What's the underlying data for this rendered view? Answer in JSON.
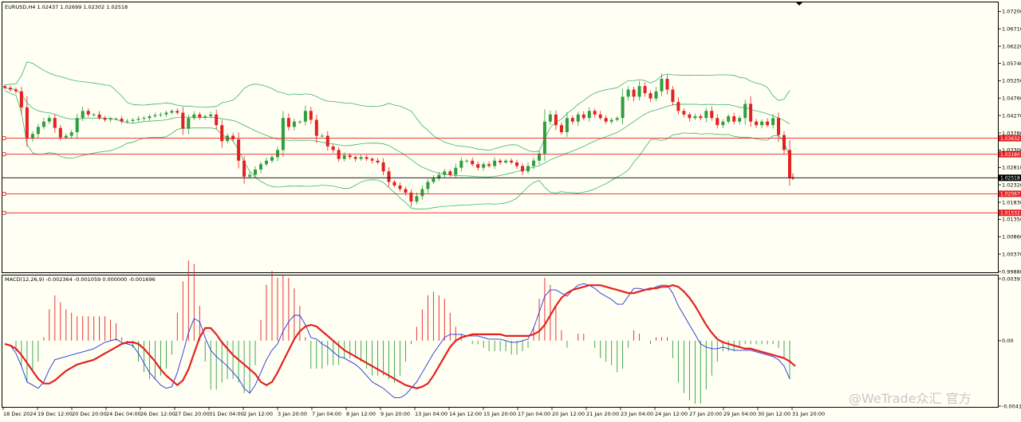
{
  "chart_data": [
    {
      "type": "candlestick",
      "symbol_line": "EURUSD,H4  1.02437 1.02699 1.02302 1.02518",
      "ylim": [
        0.9988,
        1.0732
      ],
      "y_ticks": [
        1.072,
        1.0671,
        1.0622,
        1.0574,
        1.0525,
        1.0476,
        1.0427,
        1.0378,
        1.033,
        1.0281,
        1.0232,
        1.0183,
        1.0135,
        1.0086,
        1.0037,
        0.9988
      ],
      "y_tick_labels": [
        "1.07200",
        "1.06710",
        "1.06220",
        "1.05740",
        "1.05250",
        "1.04760",
        "1.04270",
        "1.03780",
        "1.03300",
        "1.02810",
        "1.02320",
        "1.01830",
        "1.01350",
        "1.00860",
        "1.00370",
        "0.99880"
      ],
      "x_tick_labels": [
        "18 Dec 2024",
        "19 Dec 12:00",
        "20 Dec 20:00",
        "24 Dec 04:00",
        "26 Dec 12:00",
        "27 Dec 20:00",
        "31 Dec 04:00",
        "2 Jan 12:00",
        "3 Jan 20:00",
        "7 Jan 04:00",
        "8 Jan 12:00",
        "9 Jan 20:00",
        "13 Jan 04:00",
        "14 Jan 12:00",
        "15 Jan 20:00",
        "17 Jan 04:00",
        "20 Jan 12:00",
        "21 Jan 20:00",
        "23 Jan 04:00",
        "24 Jan 12:00",
        "27 Jan 20:00",
        "29 Jan 04:00",
        "30 Jan 12:00",
        "31 Jan 20:00"
      ],
      "close_series": [
        1.0505,
        1.05,
        1.0495,
        1.045,
        1.0362,
        1.0375,
        1.0395,
        1.041,
        1.042,
        1.0392,
        1.0365,
        1.037,
        1.038,
        1.042,
        1.044,
        1.043,
        1.043,
        1.042,
        1.0415,
        1.0418,
        1.0418,
        1.041,
        1.0412,
        1.0415,
        1.0418,
        1.042,
        1.0425,
        1.0428,
        1.043,
        1.0435,
        1.044,
        1.0435,
        1.039,
        1.042,
        1.043,
        1.0422,
        1.0425,
        1.043,
        1.04,
        1.0355,
        1.037,
        1.036,
        1.03,
        1.0255,
        1.026,
        1.0275,
        1.029,
        1.03,
        1.031,
        1.033,
        1.042,
        1.0395,
        1.041,
        1.041,
        1.044,
        1.0415,
        1.037,
        1.037,
        1.034,
        1.033,
        1.0305,
        1.0315,
        1.031,
        1.0305,
        1.031,
        1.0305,
        1.03,
        1.0295,
        1.027,
        1.024,
        1.023,
        1.022,
        1.021,
        1.0185,
        1.02,
        1.022,
        1.024,
        1.025,
        1.026,
        1.027,
        1.026,
        1.028,
        1.03,
        1.03,
        1.029,
        1.028,
        1.029,
        1.0285,
        1.03,
        1.0295,
        1.03,
        1.0295,
        1.0285,
        1.027,
        1.0285,
        1.03,
        1.032,
        1.041,
        1.043,
        1.04,
        1.038,
        1.042,
        1.041,
        1.043,
        1.042,
        1.044,
        1.043,
        1.042,
        1.041,
        1.0415,
        1.042,
        1.048,
        1.05,
        1.048,
        1.051,
        1.049,
        1.0475,
        1.0495,
        1.053,
        1.05,
        1.0465,
        1.044,
        1.043,
        1.042,
        1.0425,
        1.042,
        1.044,
        1.042,
        1.04,
        1.041,
        1.0425,
        1.041,
        1.042,
        1.046,
        1.041,
        1.04,
        1.041,
        1.04,
        1.042,
        1.0372,
        1.033,
        1.0252
      ],
      "horizontal_levels": [
        {
          "label": "1.03632",
          "value": 1.03632,
          "color": "#e52020"
        },
        {
          "label": "1.03180",
          "value": 1.0318,
          "color": "#e52020"
        },
        {
          "label": "1.02518",
          "value": 1.02518,
          "color": "#000000"
        },
        {
          "label": "1.02067",
          "value": 1.02067,
          "color": "#e52020"
        },
        {
          "label": "1.01532",
          "value": 1.01532,
          "color": "#e52020"
        }
      ],
      "bollinger": true,
      "colors": {
        "bull": "#2e9e3e",
        "bear": "#e52020",
        "band": "#3cb371",
        "grid": "none"
      }
    },
    {
      "type": "macd",
      "label": "MACD(12,26,9) -0.002364 -0.001059 0.000000 -0.001696",
      "ylim": [
        -0.00412,
        0.00391
      ],
      "y_tick_labels": [
        "0.00391",
        "0.00",
        "-0.00412"
      ],
      "y_ticks": [
        0.00391,
        0.0,
        -0.00412
      ],
      "macd_line": [
        -0.0002,
        -0.0003,
        -0.0008,
        -0.0016,
        -0.0026,
        -0.0028,
        -0.003,
        -0.0026,
        -0.0018,
        -0.0012,
        -0.0011,
        -0.001,
        -0.0009,
        -0.0008,
        -0.0007,
        -0.0006,
        -0.0005,
        -0.0003,
        -0.0001,
        0.0,
        0.0001,
        -0.0001,
        -0.0002,
        -0.0003,
        -0.0008,
        -0.0014,
        -0.002,
        -0.0024,
        -0.0028,
        -0.003,
        -0.0029,
        -0.002,
        -0.0008,
        0.0005,
        0.0014,
        0.0012,
        0.0002,
        -0.0006,
        -0.001,
        -0.0013,
        -0.0016,
        -0.002,
        -0.0024,
        -0.003,
        -0.0033,
        -0.0028,
        -0.002,
        -0.0012,
        -0.0006,
        -0.0002,
        0.0006,
        0.0012,
        0.0016,
        0.0016,
        0.001,
        0.0002,
        0.0001,
        -0.0002,
        -0.0004,
        -0.0007,
        -0.001,
        -0.0011,
        -0.0013,
        -0.0015,
        -0.0018,
        -0.0022,
        -0.0026,
        -0.0028,
        -0.003,
        -0.0033,
        -0.0036,
        -0.0036,
        -0.0034,
        -0.003,
        -0.0026,
        -0.002,
        -0.0014,
        -0.0008,
        -0.0003,
        0.0002,
        0.0004,
        0.0004,
        0.0004,
        0.0003,
        0.0003,
        0.0003,
        0.0002,
        0.0001,
        0.0001,
        0.0001,
        0.0,
        -0.0001,
        -0.0001,
        0.0,
        0.0001,
        0.0008,
        0.0018,
        0.0028,
        0.0032,
        0.0032,
        0.003,
        0.0028,
        0.0032,
        0.0035,
        0.0036,
        0.0035,
        0.0033,
        0.003,
        0.0028,
        0.0026,
        0.0023,
        0.0023,
        0.0028,
        0.0033,
        0.0033,
        0.0032,
        0.0032,
        0.0034,
        0.0035,
        0.0035,
        0.003,
        0.0022,
        0.0016,
        0.001,
        0.0004,
        -0.0002,
        -0.0004,
        -0.0005,
        -0.0005,
        -0.0004,
        -0.0005,
        -0.0006,
        -0.0006,
        -0.0006,
        -0.0006,
        -0.0007,
        -0.0008,
        -0.0009,
        -0.001,
        -0.0012,
        -0.0016,
        -0.0024
      ],
      "signal_line": [
        -0.0002,
        -0.0003,
        -0.0005,
        -0.0009,
        -0.0014,
        -0.0019,
        -0.0024,
        -0.0027,
        -0.0027,
        -0.0025,
        -0.0022,
        -0.0019,
        -0.0017,
        -0.0015,
        -0.0014,
        -0.0013,
        -0.0012,
        -0.001,
        -0.0008,
        -0.0006,
        -0.0004,
        -0.0002,
        -0.0001,
        -0.0001,
        -0.0002,
        -0.0005,
        -0.0009,
        -0.0013,
        -0.0018,
        -0.0022,
        -0.0025,
        -0.0028,
        -0.0025,
        -0.0018,
        -0.0008,
        0.0002,
        0.0008,
        0.0008,
        0.0004,
        -0.0001,
        -0.0005,
        -0.0009,
        -0.0012,
        -0.0015,
        -0.0018,
        -0.0021,
        -0.0026,
        -0.0028,
        -0.0026,
        -0.002,
        -0.0013,
        -0.0006,
        0.0001,
        0.0006,
        0.0009,
        0.001,
        0.0009,
        0.0006,
        0.0003,
        0.0,
        -0.0003,
        -0.0006,
        -0.0008,
        -0.001,
        -0.0012,
        -0.0014,
        -0.0016,
        -0.0018,
        -0.002,
        -0.0022,
        -0.0024,
        -0.0026,
        -0.0028,
        -0.0029,
        -0.003,
        -0.0029,
        -0.0027,
        -0.0022,
        -0.0016,
        -0.001,
        -0.0004,
        0.0,
        0.0002,
        0.0003,
        0.0004,
        0.0004,
        0.0004,
        0.0004,
        0.0004,
        0.0004,
        0.0003,
        0.0003,
        0.0003,
        0.0003,
        0.0003,
        0.0004,
        0.0006,
        0.001,
        0.0016,
        0.0022,
        0.0027,
        0.003,
        0.0032,
        0.0033,
        0.0034,
        0.0035,
        0.0035,
        0.0035,
        0.0034,
        0.0033,
        0.0032,
        0.0031,
        0.003,
        0.003,
        0.0031,
        0.0032,
        0.0033,
        0.0033,
        0.0034,
        0.0034,
        0.0035,
        0.0034,
        0.0031,
        0.0027,
        0.0022,
        0.0016,
        0.001,
        0.0005,
        0.0001,
        -0.0001,
        -0.0002,
        -0.0003,
        -0.0004,
        -0.0005,
        -0.0005,
        -0.0006,
        -0.0007,
        -0.0008,
        -0.0009,
        -0.001,
        -0.0011,
        -0.0013,
        -0.0016
      ],
      "colors": {
        "macd": "#2233dd",
        "signal": "#e52020",
        "hist_pos": "#e52020",
        "hist_neg": "#2e9e3e"
      }
    }
  ],
  "watermark": "@WeTrade众汇 官方",
  "marker_icon": "triangle-down-icon"
}
